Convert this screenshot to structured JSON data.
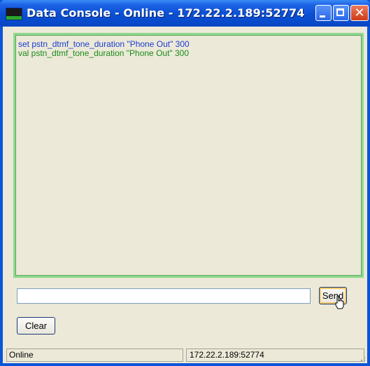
{
  "window": {
    "title": "Data Console - Online - 172.22.2.189:52774",
    "icon": "data-console-app-icon"
  },
  "titlebar_buttons": {
    "minimize_icon": "minimize-icon",
    "maximize_icon": "maximize-icon",
    "close_icon": "close-icon",
    "close_glyph": "✕"
  },
  "output": {
    "lines": [
      {
        "text": "set pstn_dtmf_tone_duration \"Phone Out\" 300",
        "color": "#1a3ccf"
      },
      {
        "text": "val pstn_dtmf_tone_duration \"Phone Out\" 300",
        "color": "#1a8a1a"
      }
    ],
    "border_color": "#8fd98f"
  },
  "command": {
    "value": "",
    "placeholder": ""
  },
  "buttons": {
    "send_label": "Send",
    "clear_label": "Clear"
  },
  "statusbar": {
    "status": "Online",
    "address": "172.22.2.189:52774"
  },
  "colors": {
    "titlebar": "#0a4fd2",
    "client_bg": "#ece9d8",
    "send_focus": "#f6c96a"
  }
}
